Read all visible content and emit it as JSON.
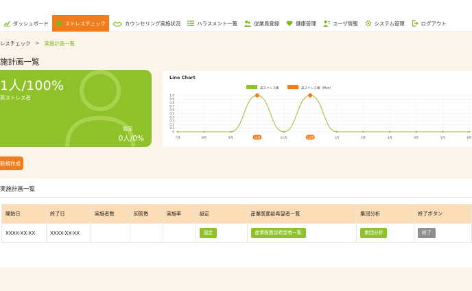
{
  "nav": {
    "items": [
      {
        "label": "ダッシュボード",
        "icon": "chart-icon",
        "active": false
      },
      {
        "label": "ストレスチェック",
        "icon": "leaf-icon",
        "active": true
      },
      {
        "label": "カウンセリング実施状況",
        "icon": "handshake-icon",
        "active": false
      },
      {
        "label": "ハラスメント一覧",
        "icon": "list-icon",
        "active": false
      },
      {
        "label": "従業員登録",
        "icon": "users-icon",
        "active": false
      },
      {
        "label": "健康管理",
        "icon": "heart-icon",
        "active": false
      },
      {
        "label": "ユーザ情報",
        "icon": "user-info-icon",
        "active": false
      },
      {
        "label": "システム管理",
        "icon": "gear-icon",
        "active": false
      },
      {
        "label": "ログアウト",
        "icon": "logout-icon",
        "active": false
      }
    ],
    "active_color": "#f07c1b"
  },
  "breadcrumb": {
    "parent": "レスチェック",
    "separator": ">",
    "current": "実施計画一覧"
  },
  "page_title": "施計画一覧",
  "stat_card": {
    "main": "1人/100%",
    "label": "高ストレス者",
    "prev_label": "前回",
    "prev_value": "0人/0%",
    "color": "#8fc22a"
  },
  "chart_data": {
    "type": "line",
    "title": "Line Chart",
    "legend": [
      "高ストレス者",
      "高ストレス者（Max）"
    ],
    "legend_placement": "top-center",
    "categories": [
      "7月",
      "8月",
      "9月",
      "10月",
      "11月",
      "12月",
      "1月",
      "2月",
      "3月",
      "4月",
      "5月",
      "6月"
    ],
    "highlight_categories": [
      "10月",
      "12月"
    ],
    "series": [
      {
        "name": "高ストレス者",
        "values": [
          0,
          0,
          0,
          1,
          0,
          1,
          0,
          0,
          0,
          0,
          0,
          0
        ],
        "color": "#8fc22a"
      },
      {
        "name": "高ストレス者（Max）",
        "values": [
          null,
          null,
          null,
          1,
          null,
          1,
          null,
          null,
          null,
          null,
          null,
          null
        ],
        "color": "#f07c1b"
      }
    ],
    "yticks": [
      "1.0",
      "0.9",
      "0.8",
      "0.7",
      "0.6",
      "0.5",
      "0.4",
      "0.3",
      "0.2",
      "0.1",
      "0"
    ],
    "ylim": [
      0,
      1
    ],
    "grid": true
  },
  "new_button": "新規作成",
  "list": {
    "title": "実施計画一覧",
    "columns": [
      "開始日",
      "終了日",
      "実施者数",
      "回答数",
      "実施率",
      "設定",
      "産業医面談希望者一覧",
      "集団分析",
      "終了ボタン"
    ],
    "rows": [
      {
        "start": "XXXX-XX-XX",
        "end": "XXXX-XX-XX",
        "participants": "",
        "answers": "",
        "rate": "",
        "settings_btn": "設定",
        "doctor_btn": "産業医面談希望者一覧",
        "analysis_btn": "集団分析",
        "end_btn": "終了"
      }
    ]
  }
}
